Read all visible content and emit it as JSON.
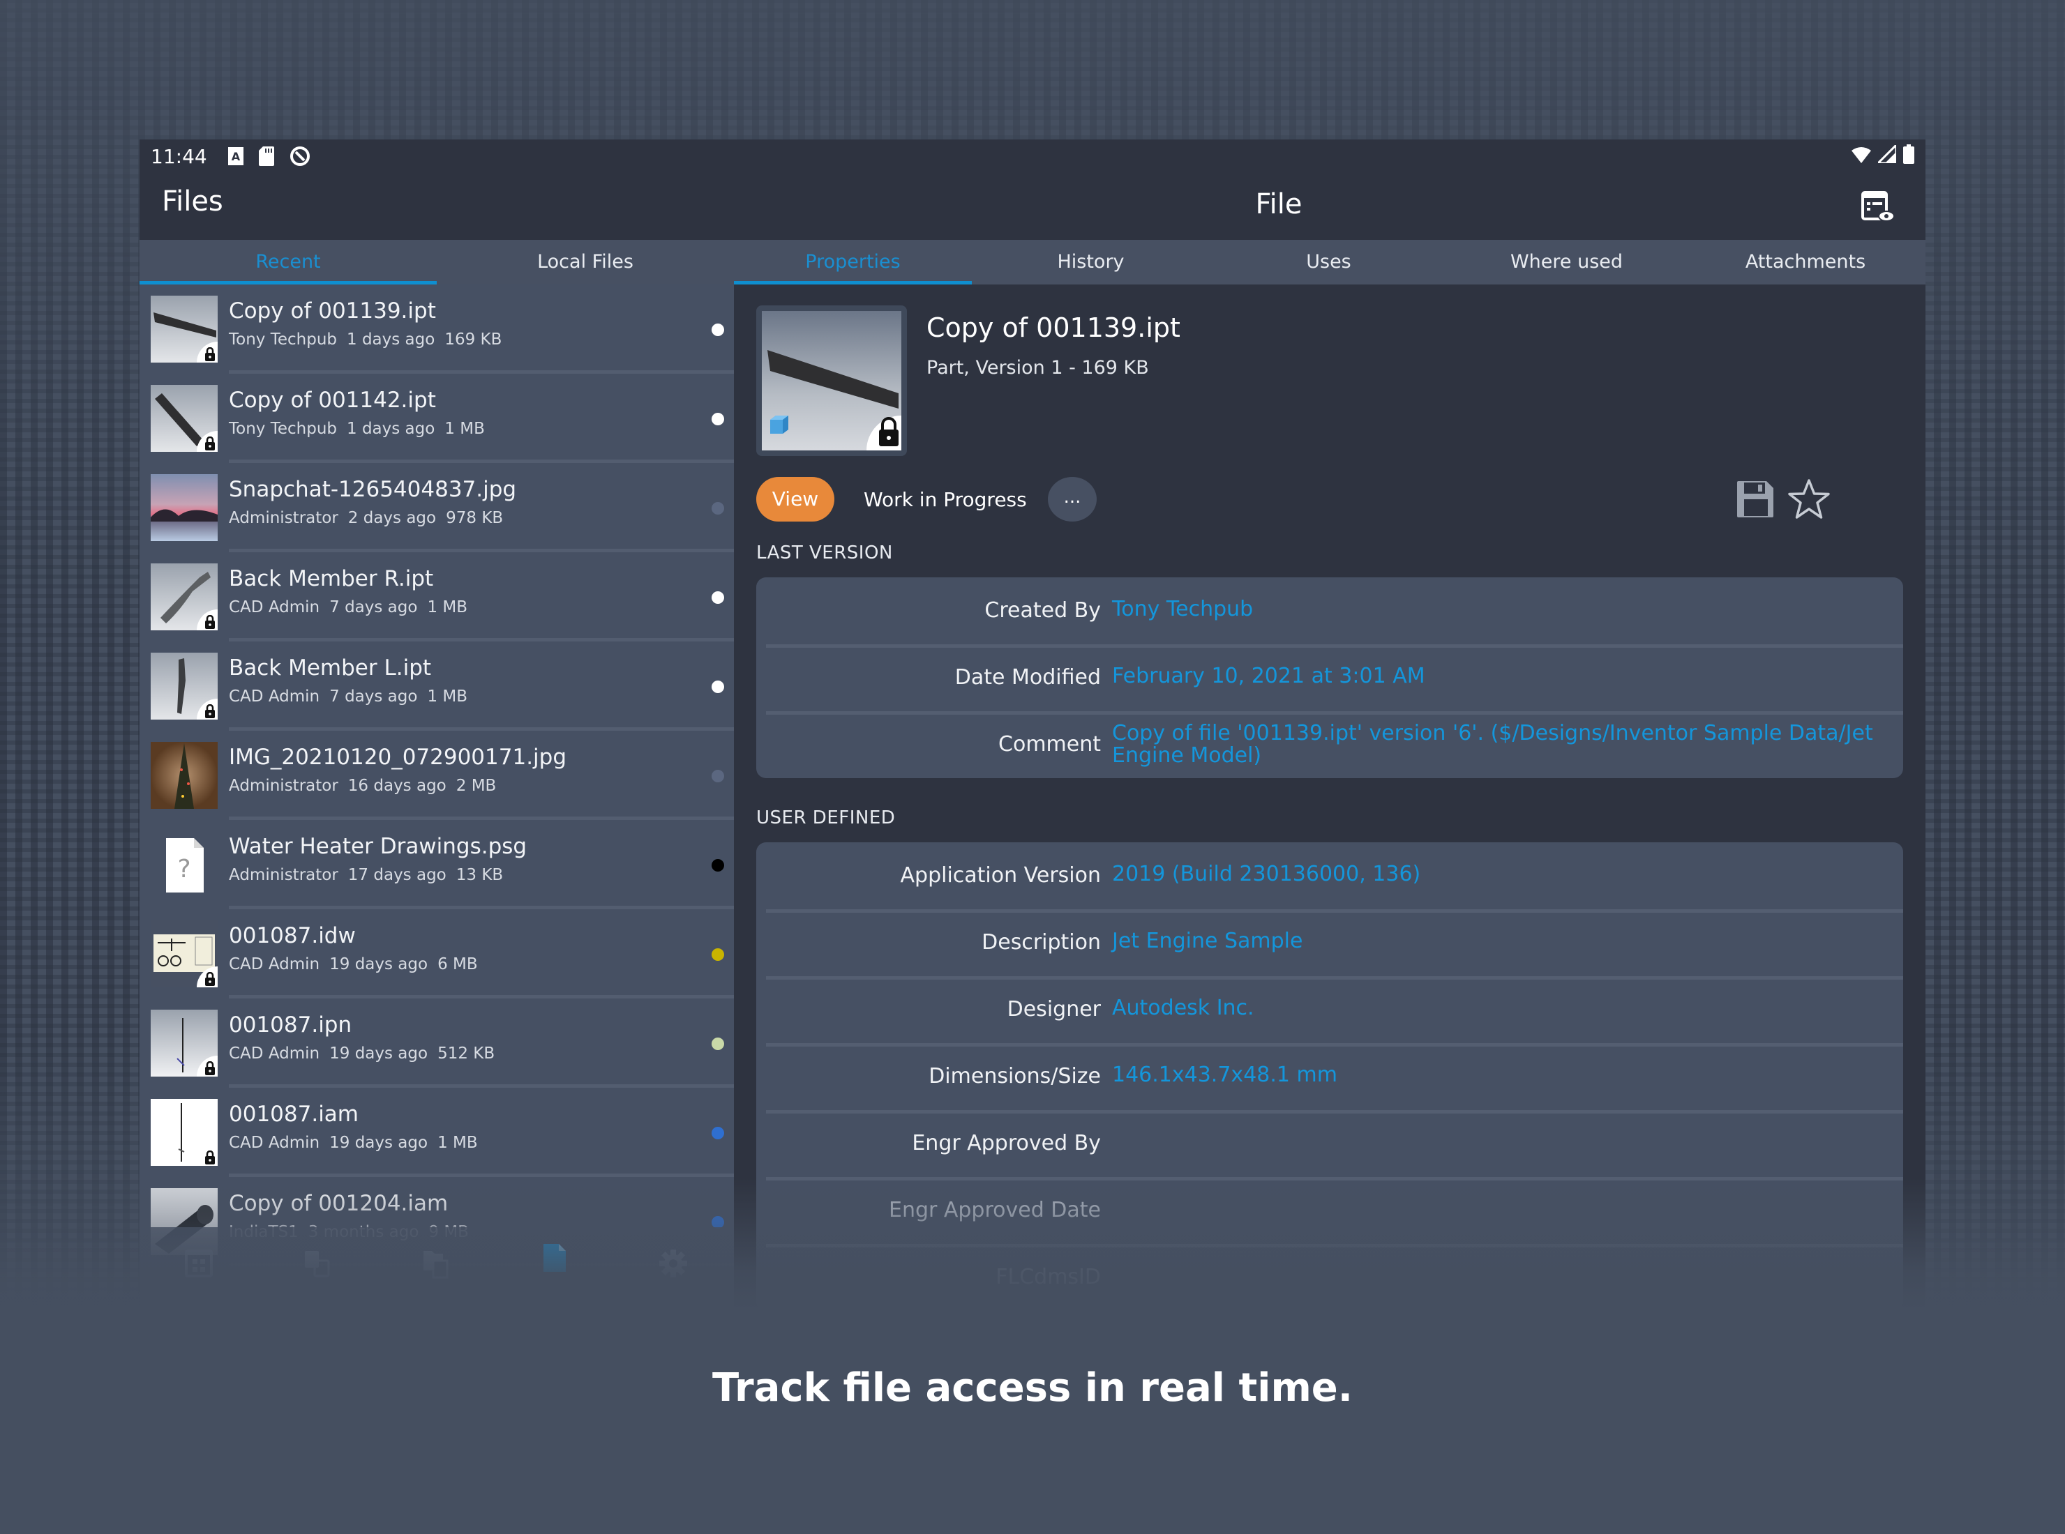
{
  "status_bar": {
    "time": "11:44",
    "icons": [
      "keyboard-a-icon",
      "sd-card-icon",
      "sync-icon"
    ],
    "right_icons": [
      "wifi-icon",
      "signal-icon",
      "battery-icon"
    ]
  },
  "app_bar": {
    "left_title": "Files",
    "center_title": "File",
    "action_icon": "properties-view-icon"
  },
  "left_tabs": [
    {
      "label": "Recent",
      "active": true
    },
    {
      "label": "Local Files",
      "active": false
    }
  ],
  "right_tabs": [
    {
      "label": "Properties",
      "active": true
    },
    {
      "label": "History",
      "active": false
    },
    {
      "label": "Uses",
      "active": false
    },
    {
      "label": "Where used",
      "active": false
    },
    {
      "label": "Attachments",
      "active": false
    }
  ],
  "files": [
    {
      "name": "Copy of 001139.ipt",
      "user": "Tony Techpub",
      "age": "1 days ago",
      "size": "169 KB",
      "status_color": "#ffffff",
      "locked": true,
      "thumb": "part-dark-bar"
    },
    {
      "name": "Copy of 001142.ipt",
      "user": "Tony Techpub",
      "age": "1 days ago",
      "size": "1 MB",
      "status_color": "#ffffff",
      "locked": true,
      "thumb": "part-diagonal"
    },
    {
      "name": "Snapchat-1265404837.jpg",
      "user": "Administrator",
      "age": "2 days ago",
      "size": "978 KB",
      "status_color": "#5b6780",
      "locked": false,
      "thumb": "sunset-photo"
    },
    {
      "name": "Back Member R.ipt",
      "user": "CAD Admin",
      "age": "7 days ago",
      "size": "1 MB",
      "status_color": "#ffffff",
      "locked": true,
      "thumb": "part-curved"
    },
    {
      "name": "Back Member L.ipt",
      "user": "CAD Admin",
      "age": "7 days ago",
      "size": "1 MB",
      "status_color": "#ffffff",
      "locked": true,
      "thumb": "part-vertical"
    },
    {
      "name": "IMG_20210120_072900171.jpg",
      "user": "Administrator",
      "age": "16 days ago",
      "size": "2 MB",
      "status_color": "#5b6780",
      "locked": false,
      "thumb": "tree-photo"
    },
    {
      "name": "Water Heater Drawings.psg",
      "user": "Administrator",
      "age": "17 days ago",
      "size": "13 KB",
      "status_color": "#000000",
      "locked": false,
      "thumb": "unknown-file"
    },
    {
      "name": "001087.idw",
      "user": "CAD Admin",
      "age": "19 days ago",
      "size": "6 MB",
      "status_color": "#c8b400",
      "locked": true,
      "thumb": "drawing-sheet"
    },
    {
      "name": "001087.ipn",
      "user": "CAD Admin",
      "age": "19 days ago",
      "size": "512 KB",
      "status_color": "#c9d9a8",
      "locked": true,
      "thumb": "presentation-rod"
    },
    {
      "name": "001087.iam",
      "user": "CAD Admin",
      "age": "19 days ago",
      "size": "1 MB",
      "status_color": "#2f6fd0",
      "locked": true,
      "thumb": "assembly-rod"
    },
    {
      "name": "Copy of 001204.iam",
      "user": "IndiaTS1",
      "age": "3 months ago",
      "size": "9 MB",
      "status_color": "#2f6fd0",
      "locked": false,
      "thumb": "jet-engine"
    }
  ],
  "bottom_nav": [
    {
      "icon": "dashboard-icon",
      "active": false
    },
    {
      "icon": "copy-design-icon",
      "active": false
    },
    {
      "icon": "project-files-icon",
      "active": false
    },
    {
      "icon": "file-icon",
      "active": true
    },
    {
      "icon": "settings-gear-icon",
      "active": false
    }
  ],
  "detail": {
    "title": "Copy of 001139.ipt",
    "subtitle": "Part, Version 1 - 169 KB",
    "view_label": "View",
    "state": "Work in Progress",
    "more_label": "...",
    "save_icon": "save-icon",
    "favorite_icon": "star-icon",
    "last_version_label": "LAST VERSION",
    "last_version": [
      {
        "label": "Created By",
        "value": "Tony Techpub"
      },
      {
        "label": "Date Modified",
        "value": "February 10, 2021 at 3:01 AM"
      },
      {
        "label": "Comment",
        "value": "Copy of file '001139.ipt' version '6'. ($/Designs/Inventor Sample Data/Jet Engine Model)"
      }
    ],
    "user_defined_label": "USER DEFINED",
    "user_defined": [
      {
        "label": "Application Version",
        "value": "2019 (Build 230136000, 136)"
      },
      {
        "label": "Description",
        "value": "Jet Engine Sample"
      },
      {
        "label": "Designer",
        "value": "Autodesk Inc."
      },
      {
        "label": "Dimensions/Size",
        "value": "146.1x43.7x48.1 mm"
      },
      {
        "label": "Engr Approved By",
        "value": ""
      },
      {
        "label": "Engr Approved Date",
        "value": ""
      },
      {
        "label": "FLCdmsID",
        "value": ""
      }
    ]
  },
  "colors": {
    "accent": "#0f8fd0",
    "value_text": "#1496db",
    "view_button": "#e8893a"
  },
  "caption": "Track file access in real time."
}
